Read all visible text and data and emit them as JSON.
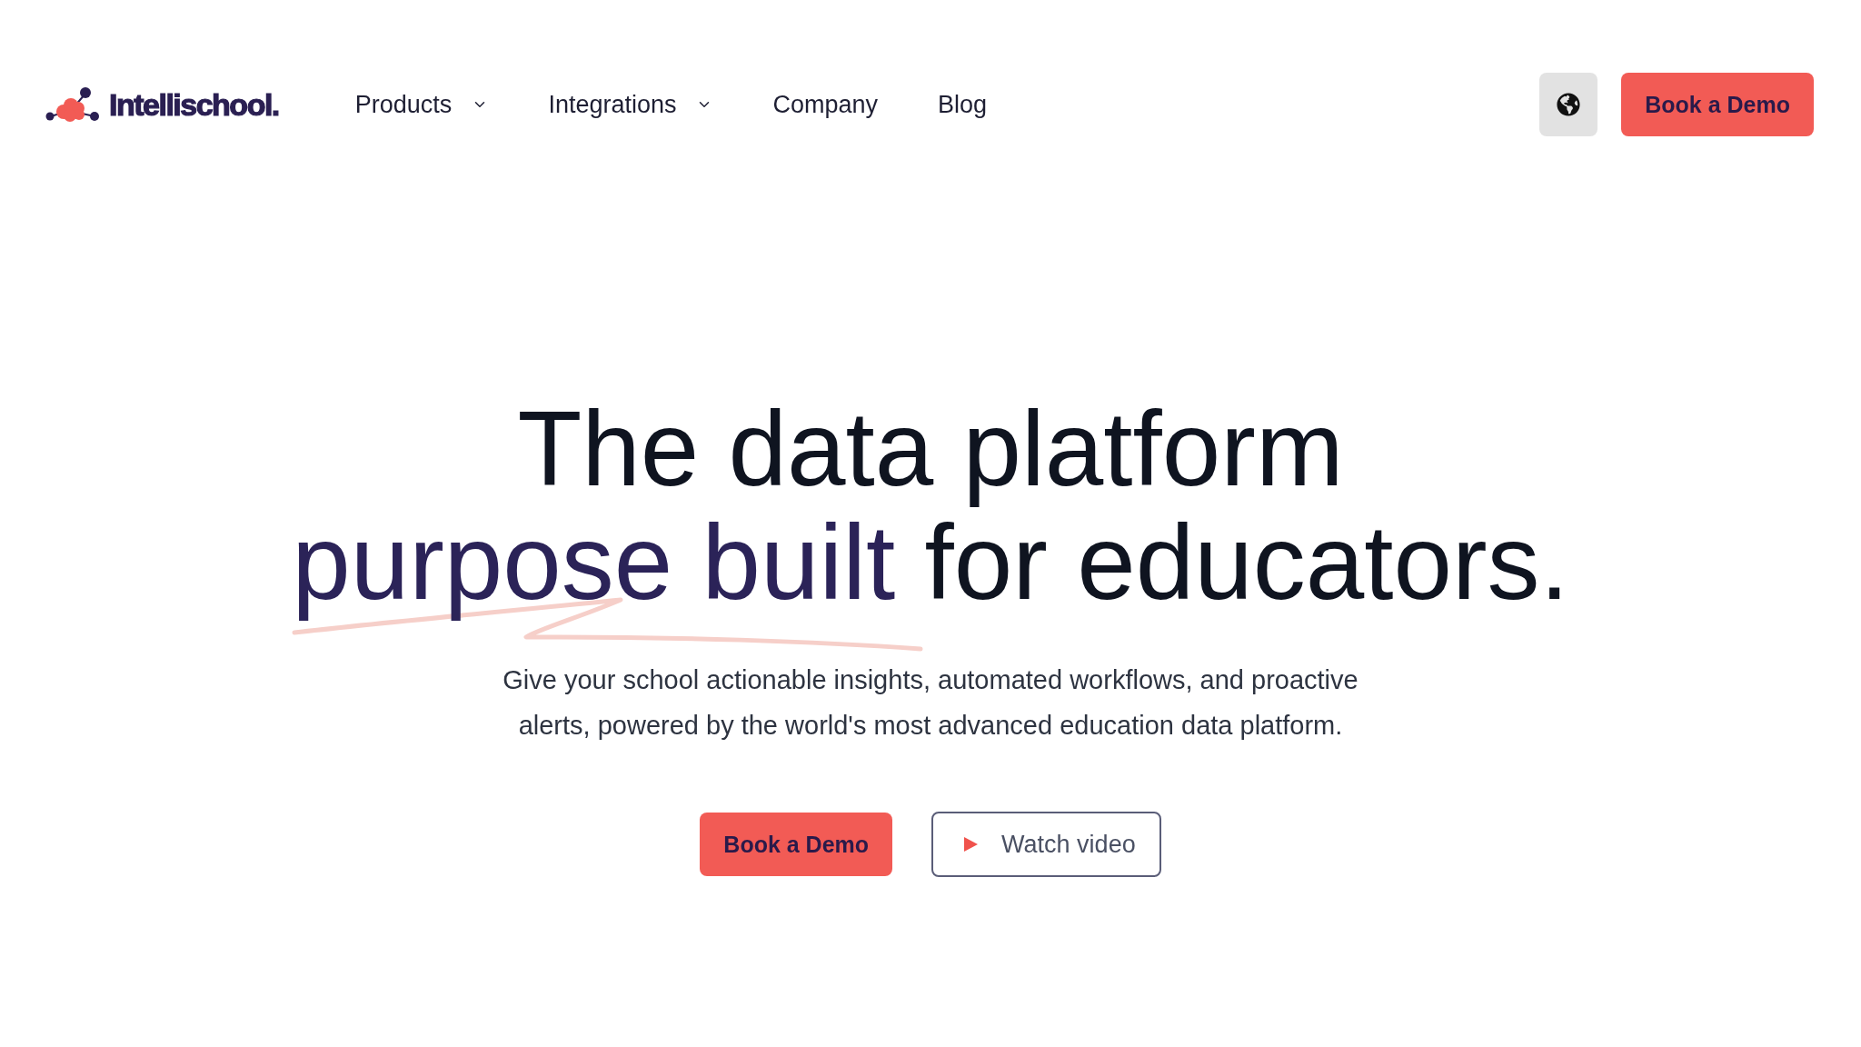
{
  "header": {
    "logo": {
      "text": "Intellischool."
    },
    "nav": [
      {
        "label": "Products",
        "has_menu": true
      },
      {
        "label": "Integrations",
        "has_menu": true
      },
      {
        "label": "Company",
        "has_menu": false
      },
      {
        "label": "Blog",
        "has_menu": false
      }
    ],
    "cta": "Book a Demo"
  },
  "hero": {
    "headline": {
      "line_1": "The data platform",
      "highlight": "purpose built",
      "rest": "for educators."
    },
    "subtitle": "Give your school actionable insights, automated workflows, and proactive alerts, powered by the world's most advanced education data platform.",
    "buttons": [
      {
        "kind": "primary",
        "label": "Book a Demo"
      },
      {
        "kind": "video",
        "label": "Watch video"
      }
    ]
  }
}
